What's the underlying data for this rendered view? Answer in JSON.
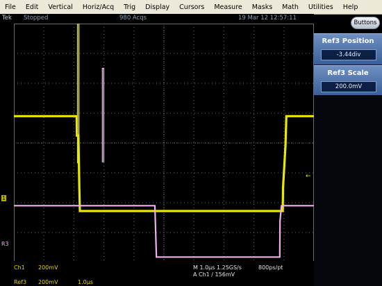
{
  "menu": [
    "File",
    "Edit",
    "Vertical",
    "Horiz/Acq",
    "Trig",
    "Display",
    "Cursors",
    "Measure",
    "Masks",
    "Math",
    "Utilities",
    "Help"
  ],
  "status": {
    "brand": "Tek",
    "state": "Stopped",
    "acqs": "980 Acqs",
    "datetime": "19 Mar 12 12:57:11"
  },
  "buttons_label": "Buttons",
  "ref3_position": {
    "title": "Ref3 Position",
    "value": "-3.44div"
  },
  "ref3_scale": {
    "title": "Ref3 Scale",
    "value": "200.0mV"
  },
  "markers": {
    "ch1": "1",
    "r3": "R3"
  },
  "readout": {
    "ch1_label": "Ch1",
    "ch1_scale": "200mV",
    "ref3_label": "Ref3",
    "ref3_scale": "200mV",
    "ref3_time": "1.0µs",
    "timebase": "M 1.0µs 1.25GS/s",
    "resolution": "800ps/pt",
    "trigger": "A Ch1 ∕ 156mV"
  },
  "colors": {
    "ch1": "#e8e800",
    "ref3": "#f0b0f0",
    "grid": "#6a6a6a"
  },
  "chart_data": {
    "type": "line",
    "x_range_div": [
      0,
      10
    ],
    "y_range_div": [
      0,
      8
    ],
    "grid": true,
    "series": [
      {
        "name": "Ch1",
        "points": [
          [
            0,
            4.9
          ],
          [
            2.09,
            4.9
          ],
          [
            2.1,
            4.25
          ],
          [
            2.15,
            4.25
          ],
          [
            2.18,
            2.5
          ],
          [
            2.2,
            1.72
          ],
          [
            8.96,
            1.72
          ],
          [
            8.97,
            2.5
          ],
          [
            9.05,
            3.9
          ],
          [
            9.08,
            4.9
          ],
          [
            10,
            4.9
          ]
        ],
        "spikes": [
          [
            2.12,
            3.32,
            8.7
          ]
        ]
      },
      {
        "name": "Ref3",
        "points": [
          [
            0,
            1.9
          ],
          [
            4.69,
            1.9
          ],
          [
            4.7,
            1.9
          ],
          [
            4.75,
            0.18
          ],
          [
            8.86,
            0.18
          ],
          [
            8.87,
            1.4
          ],
          [
            8.92,
            1.9
          ],
          [
            10,
            1.9
          ]
        ],
        "spikes": [
          [
            2.95,
            3.35,
            6.5
          ]
        ]
      }
    ]
  }
}
